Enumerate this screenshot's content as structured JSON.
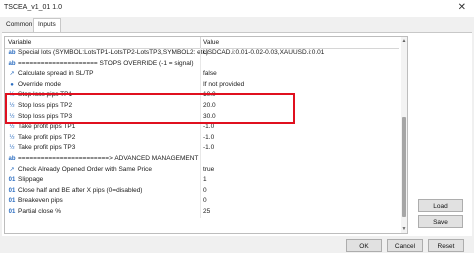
{
  "window": {
    "title": "TSCEA_v1_01 1.0",
    "close_glyph": "✕"
  },
  "tabs": [
    {
      "label": "Common"
    },
    {
      "label": "Inputs"
    }
  ],
  "table": {
    "headers": {
      "variable": "Variable",
      "value": "Value"
    },
    "rows": [
      {
        "icon": "ab-icon",
        "glyph": "ab",
        "name": "Special lots (SYMBOL:LotsTP1-LotsTP2-LotsTP3,SYMBOL2: etc)",
        "value": "USDCAD.i:0.01-0.02-0.03,XAUUSD.i:0.01"
      },
      {
        "icon": "ab-icon",
        "glyph": "ab",
        "name": "===================== STOPS OVERRIDE (-1 = signal)",
        "value": ""
      },
      {
        "icon": "bool-icon",
        "glyph": "↗",
        "name": "Calculate spread in SL/TP",
        "value": "false"
      },
      {
        "icon": "enum-icon",
        "glyph": "●",
        "name": "Override mode",
        "value": "If not provided"
      },
      {
        "icon": "double-icon",
        "glyph": "½",
        "name": "Stop loss pips TP1",
        "value": "10.0"
      },
      {
        "icon": "double-icon",
        "glyph": "½",
        "name": "Stop loss pips TP2",
        "value": "20.0"
      },
      {
        "icon": "double-icon",
        "glyph": "½",
        "name": "Stop loss pips TP3",
        "value": "30.0"
      },
      {
        "icon": "double-icon",
        "glyph": "½",
        "name": "Take profit pips TP1",
        "value": "-1.0"
      },
      {
        "icon": "double-icon",
        "glyph": "½",
        "name": "Take profit pips TP2",
        "value": "-1.0"
      },
      {
        "icon": "double-icon",
        "glyph": "½",
        "name": "Take profit pips TP3",
        "value": "-1.0"
      },
      {
        "icon": "ab-icon",
        "glyph": "ab",
        "name": "========================> ADVANCED MANAGEMENT",
        "value": ""
      },
      {
        "icon": "bool-icon",
        "glyph": "↗",
        "name": "Check Already Opened Order with Same Price",
        "value": "true"
      },
      {
        "icon": "int-icon",
        "glyph": "01",
        "name": "Slippage",
        "value": "1"
      },
      {
        "icon": "int-icon",
        "glyph": "01",
        "name": "Close half and BE after X pips (0=disabled)",
        "value": "0"
      },
      {
        "icon": "int-icon",
        "glyph": "01",
        "name": "Breakeven pips",
        "value": "0"
      },
      {
        "icon": "int-icon",
        "glyph": "01",
        "name": "Partial close %",
        "value": "25"
      }
    ]
  },
  "buttons": {
    "load": "Load",
    "save": "Save",
    "ok": "OK",
    "cancel": "Cancel",
    "reset": "Reset"
  }
}
